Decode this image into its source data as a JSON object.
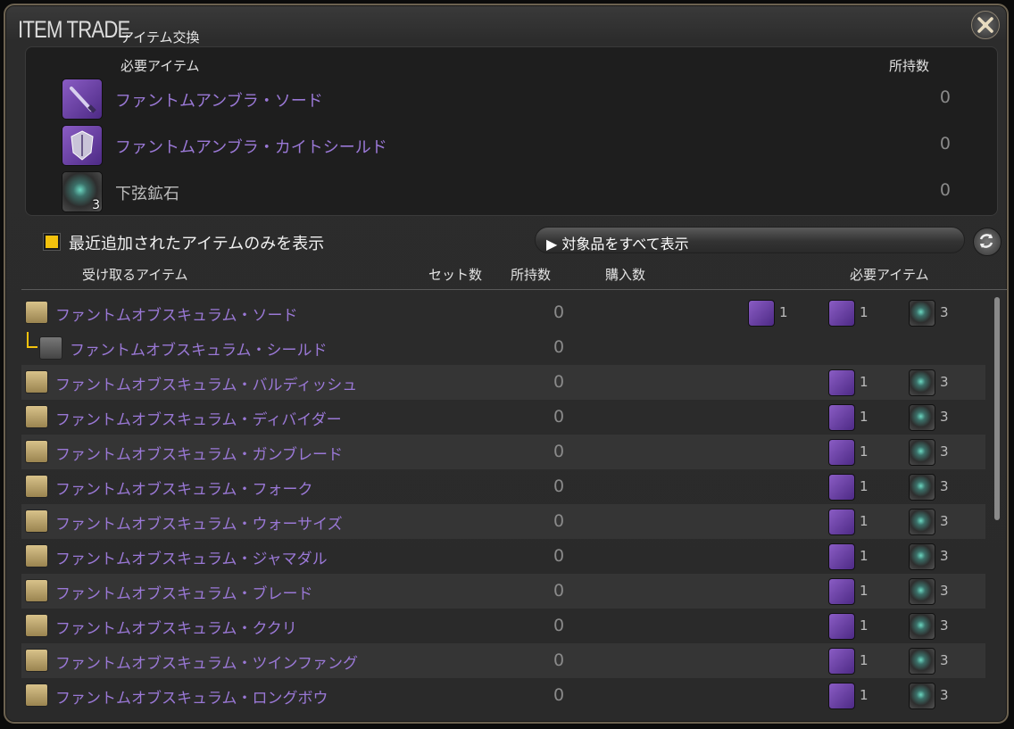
{
  "window": {
    "title": "ITEM TRADE",
    "subtitle": "アイテム交換"
  },
  "required_panel": {
    "header_item": "必要アイテム",
    "header_owned": "所持数",
    "items": [
      {
        "name": "ファントムアンブラ・ソード",
        "owned": "0",
        "color": "#9a78d6",
        "icon": "sword-icon"
      },
      {
        "name": "ファントムアンブラ・カイトシールド",
        "owned": "0",
        "color": "#9a78d6",
        "icon": "shield-icon"
      },
      {
        "name": "下弦鉱石",
        "owned": "0",
        "color": "#bdbdbd",
        "icon": "ore-icon",
        "qty": "3"
      }
    ]
  },
  "filter": {
    "label": "最近追加されたアイテムのみを表示",
    "checked": true
  },
  "show_all_button": {
    "label": "▶ 対象品をすべて表示"
  },
  "columns": {
    "receive": "受け取るアイテム",
    "sets": "セット数",
    "owned": "所持数",
    "purchase": "購入数",
    "required": "必要アイテム"
  },
  "rows": [
    {
      "name": "ファントムオブスキュラム・ソード",
      "owned": "0",
      "mats": [
        {
          "q": "1"
        },
        {
          "q": "1"
        },
        {
          "q": "3"
        }
      ],
      "three_mats": true
    },
    {
      "name": "ファントムオブスキュラム・シールド",
      "owned": "0",
      "sub": true,
      "mats": []
    },
    {
      "name": "ファントムオブスキュラム・バルディッシュ",
      "owned": "0",
      "mats": [
        {
          "q": "1"
        },
        {
          "q": "3"
        }
      ]
    },
    {
      "name": "ファントムオブスキュラム・ディバイダー",
      "owned": "0",
      "mats": [
        {
          "q": "1"
        },
        {
          "q": "3"
        }
      ]
    },
    {
      "name": "ファントムオブスキュラム・ガンブレード",
      "owned": "0",
      "mats": [
        {
          "q": "1"
        },
        {
          "q": "3"
        }
      ]
    },
    {
      "name": "ファントムオブスキュラム・フォーク",
      "owned": "0",
      "mats": [
        {
          "q": "1"
        },
        {
          "q": "3"
        }
      ]
    },
    {
      "name": "ファントムオブスキュラム・ウォーサイズ",
      "owned": "0",
      "mats": [
        {
          "q": "1"
        },
        {
          "q": "3"
        }
      ]
    },
    {
      "name": "ファントムオブスキュラム・ジャマダル",
      "owned": "0",
      "mats": [
        {
          "q": "1"
        },
        {
          "q": "3"
        }
      ]
    },
    {
      "name": "ファントムオブスキュラム・ブレード",
      "owned": "0",
      "mats": [
        {
          "q": "1"
        },
        {
          "q": "3"
        }
      ]
    },
    {
      "name": "ファントムオブスキュラム・ククリ",
      "owned": "0",
      "mats": [
        {
          "q": "1"
        },
        {
          "q": "3"
        }
      ]
    },
    {
      "name": "ファントムオブスキュラム・ツインファング",
      "owned": "0",
      "mats": [
        {
          "q": "1"
        },
        {
          "q": "3"
        }
      ]
    },
    {
      "name": "ファントムオブスキュラム・ロングボウ",
      "owned": "0",
      "mats": [
        {
          "q": "1"
        },
        {
          "q": "3"
        }
      ]
    }
  ]
}
